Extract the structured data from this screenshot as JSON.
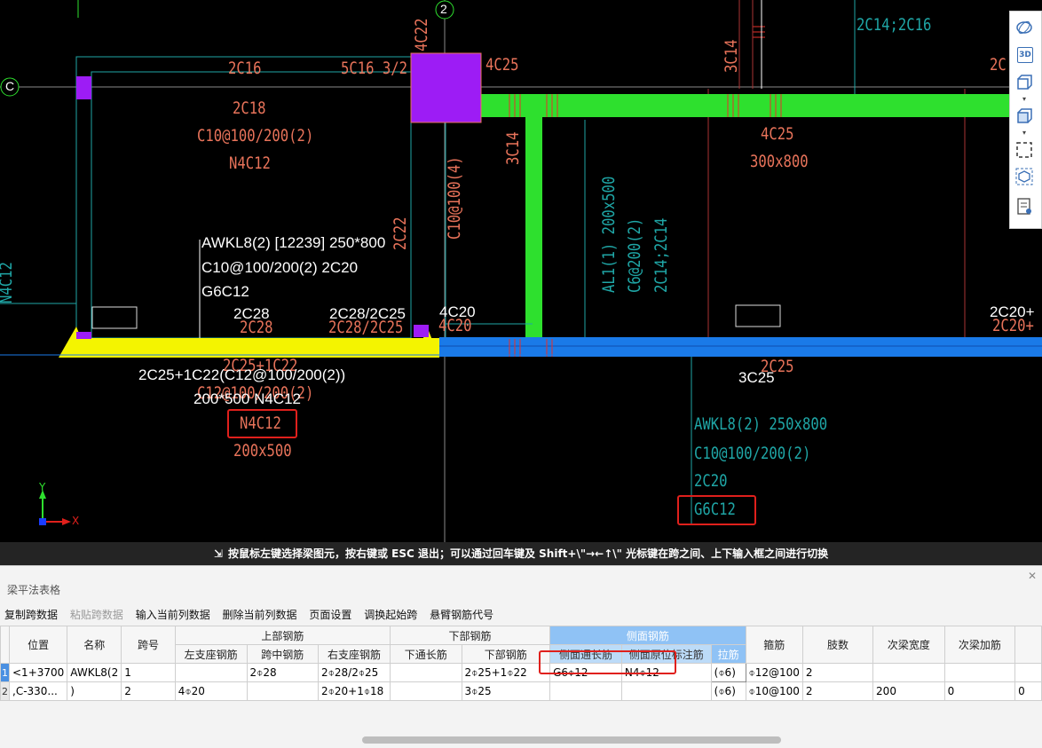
{
  "cad": {
    "axis_labels": [
      "2",
      "C"
    ],
    "beam_labels": {
      "top_left": [
        "2C16",
        "5C16 3/2",
        "2C18",
        "C10@100/200(2)",
        "N4C12"
      ],
      "col_top": "4C22",
      "col_right": "4C25",
      "right_top_vert": "3C14",
      "right_top_text": [
        "2C14;2C16",
        "2C"
      ],
      "mid_vert": [
        "3C14",
        "C10@100(4)"
      ],
      "beam_right": [
        "4C25",
        "300x800"
      ],
      "al_vert": [
        "AL1(1) 200x500",
        "C6@200(2)",
        "2C14;2C14"
      ],
      "left_vert_c22": "2C22",
      "left_edge_vert": "N4C12",
      "bottom_salmon": [
        "2C28",
        "2C28/2C25",
        "4C20",
        "2C20+",
        "2C25+1C22",
        "C12@100/200(2)",
        "N4C12",
        "200x500",
        "2C25"
      ],
      "white_annot": [
        "AWKL8(2) [12239] 250*800",
        "C10@100/200(2) 2C20",
        "G6C12",
        "2C28",
        "2C28/2C25",
        "4C20",
        "2C20+",
        "2C25+1C22(C12@100/200(2))",
        "200*500 N4C12",
        "3C25"
      ],
      "teal_block": [
        "AWKL8(2) 250x800",
        "C10@100/200(2)",
        "2C20",
        "G6C12"
      ],
      "ucs": {
        "y": "Y",
        "x": "X"
      }
    },
    "colors": {
      "beam_green": "#2ee02e",
      "beam_blue": "#1a7ae8",
      "beam_yellow": "#f4f400",
      "column_purple": "#9d1cf5",
      "salmon": "#e8735a",
      "teal": "#1fa6a6",
      "highlight_red": "#e0201c"
    }
  },
  "toolbar3d": {
    "icons": [
      "orbit-icon",
      "3d-view-icon",
      "cube-front-icon",
      "cube-iso-icon",
      "select-region-icon",
      "box-3d-icon",
      "properties-icon"
    ],
    "label_3d": "3D"
  },
  "status": {
    "message": "按鼠标左键选择梁图元，按右键或 ESC 退出；可以通过回车键及 Shift+\\\"→←↑\\\" 光标键在跨之间、上下输入框之间进行切换"
  },
  "panel": {
    "title": "梁平法表格",
    "toolbar": [
      "复制跨数据",
      "粘贴跨数据",
      "输入当前列数据",
      "删除当前列数据",
      "页面设置",
      "调换起始跨",
      "悬臂钢筋代号"
    ],
    "headers_top": [
      "位置",
      "名称",
      "跨号",
      "上部钢筋",
      "下部钢筋",
      "侧面钢筋",
      "箍筋",
      "肢数",
      "次梁宽度",
      "次梁加筋"
    ],
    "headers_sub": [
      "左支座钢筋",
      "跨中钢筋",
      "右支座钢筋",
      "下通长筋",
      "下部钢筋",
      "侧面通长筋",
      "侧面原位标注筋",
      "拉筋"
    ],
    "rows": [
      {
        "num": "1",
        "pos": "<1+3700",
        "name": "AWKL8(2",
        "span": "1",
        "left": "",
        "mid": "2⌽28",
        "right": "2⌽28/2⌽25",
        "bot_cont": "",
        "bot": "2⌽25+1⌽22",
        "side_cont": "G6⌽12",
        "side_orig": "N4⌽12",
        "tie": "(⌽6)",
        "stirrup": "⌽12@100",
        "legs": "2",
        "sec_w": "",
        "sec_add": "",
        "extra": ""
      },
      {
        "num": "2",
        "pos": ",C-330...",
        "name": ")",
        "span": "2",
        "left": "4⌽20",
        "mid": "",
        "right": "2⌽20+1⌽18",
        "bot_cont": "",
        "bot": "3⌽25",
        "side_cont": "",
        "side_orig": "",
        "tie": "(⌽6)",
        "stirrup": "⌽10@100",
        "legs": "2",
        "sec_w": "200",
        "sec_add": "0",
        "extra": "0"
      }
    ]
  }
}
